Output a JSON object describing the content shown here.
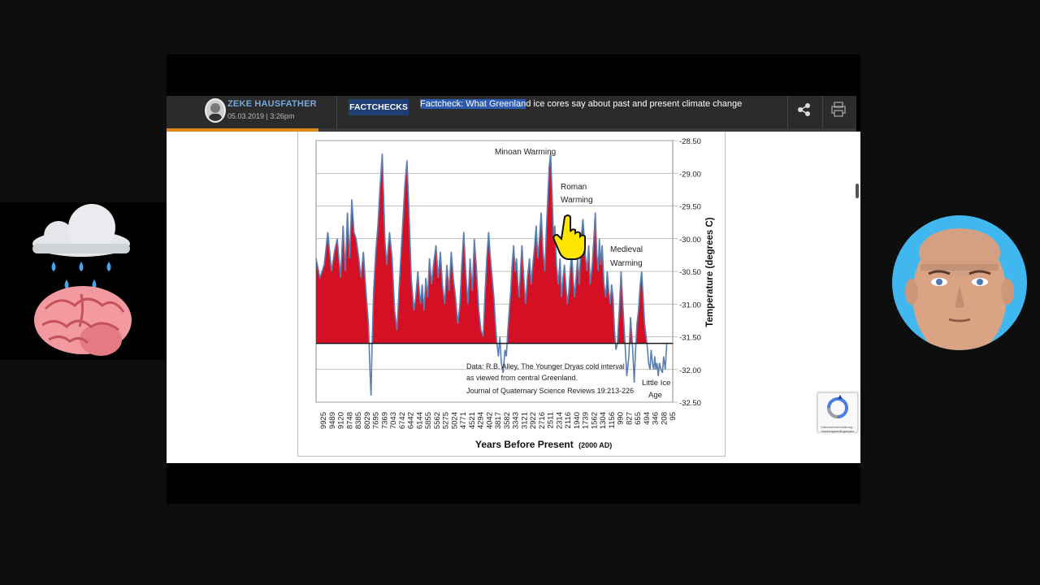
{
  "header": {
    "author_name": "ZEKE HAUSFATHER",
    "date": "05.03.2019 | 3:26pm",
    "category": "FACTCHECKS",
    "headline_selected": "Factcheck: What Greenlan",
    "headline_rest": "d ice cores say about past and present climate change",
    "progress": 0.22
  },
  "colors": {
    "fill": "#d50f24",
    "line": "#5a7fb2",
    "baseline": "#1a1a1a",
    "badge": "#1f3e73",
    "progress": "#e08a1e"
  },
  "icons": [
    "share-icon",
    "print-icon",
    "recaptcha-icon",
    "rain-cloud-icon",
    "brain-icon"
  ],
  "recaptcha_text": "Datenschutzerklärung - Nutzungsbedingungen",
  "chart_data": {
    "type": "area",
    "xlabel": "Years Before Present",
    "xlabel_small": "(2000 AD)",
    "ylabel": "Temperature (degrees C)",
    "ylim": [
      -32.5,
      -28.5
    ],
    "yticks": [
      "-28.50",
      "-29.00",
      "-29.50",
      "-30.00",
      "-30.50",
      "-31.00",
      "-31.50",
      "-32.00",
      "-32.50"
    ],
    "baseline": -31.6,
    "grid": true,
    "x_ticks": [
      "9925",
      "9489",
      "9120",
      "8748",
      "8385",
      "8029",
      "7695",
      "7369",
      "7043",
      "6742",
      "6442",
      "6144",
      "5855",
      "5562",
      "5275",
      "5024",
      "4771",
      "4521",
      "4294",
      "4042",
      "3817",
      "3582",
      "3343",
      "3121",
      "2922",
      "2716",
      "2511",
      "2314",
      "2116",
      "1940",
      "1739",
      "1562",
      "1304",
      "1156",
      "990",
      "827",
      "655",
      "494",
      "346",
      "208",
      "95"
    ],
    "x": [
      9925,
      9820,
      9700,
      9600,
      9500,
      9420,
      9340,
      9250,
      9180,
      9120,
      9060,
      9000,
      8940,
      8880,
      8820,
      8748,
      8690,
      8620,
      8550,
      8480,
      8440,
      8410,
      8385,
      8340,
      8280,
      8220,
      8160,
      8100,
      8060,
      8029,
      7980,
      7900,
      7830,
      7760,
      7695,
      7640,
      7560,
      7480,
      7420,
      7369,
      7300,
      7230,
      7180,
      7120,
      7080,
      7043,
      7000,
      6950,
      6900,
      6850,
      6800,
      6742,
      6690,
      6620,
      6560,
      6500,
      6442,
      6380,
      6320,
      6260,
      6200,
      6144,
      6080,
      6020,
      5960,
      5910,
      5855,
      5800,
      5740,
      5680,
      5620,
      5562,
      5500,
      5440,
      5380,
      5320,
      5275,
      5220,
      5170,
      5120,
      5070,
      5024,
      4980,
      4940,
      4900,
      4860,
      4820,
      4771,
      4720,
      4680,
      4640,
      4600,
      4560,
      4521,
      4480,
      4440,
      4400,
      4360,
      4330,
      4294,
      4250,
      4200,
      4150,
      4100,
      4042,
      4000,
      3950,
      3900,
      3860,
      3817,
      3770,
      3720,
      3670,
      3620,
      3582,
      3540,
      3500,
      3460,
      3420,
      3380,
      3343,
      3300,
      3250,
      3200,
      3160,
      3121,
      3080,
      3040,
      3000,
      2960,
      2922,
      2880,
      2840,
      2800,
      2760,
      2716,
      2670,
      2620,
      2570,
      2511,
      2460,
      2410,
      2370,
      2314,
      2270,
      2230,
      2190,
      2150,
      2116,
      2080,
      2040,
      1990,
      1940,
      1900,
      1860,
      1820,
      1780,
      1739,
      1700,
      1660,
      1620,
      1562,
      1520,
      1480,
      1440,
      1400,
      1360,
      1304,
      1260,
      1220,
      1190,
      1156,
      1120,
      1080,
      1040,
      990,
      950,
      910,
      870,
      827,
      790,
      760,
      720,
      690,
      655,
      620,
      590,
      560,
      530,
      494,
      460,
      420,
      380,
      346,
      300,
      260,
      208,
      170,
      130,
      95
    ],
    "values": [
      -30.3,
      -30.6,
      -30.4,
      -29.9,
      -30.5,
      -30.2,
      -30.0,
      -30.6,
      -29.8,
      -30.5,
      -29.6,
      -30.3,
      -29.4,
      -29.9,
      -30.0,
      -30.3,
      -30.6,
      -30.2,
      -30.8,
      -31.3,
      -32.0,
      -32.4,
      -31.7,
      -30.8,
      -30.2,
      -29.8,
      -29.2,
      -28.7,
      -29.4,
      -30.0,
      -30.4,
      -29.9,
      -30.3,
      -31.1,
      -31.4,
      -30.8,
      -30.0,
      -29.2,
      -28.8,
      -29.5,
      -30.6,
      -31.1,
      -30.9,
      -30.5,
      -30.8,
      -31.0,
      -30.7,
      -31.1,
      -30.6,
      -30.9,
      -30.3,
      -30.7,
      -30.4,
      -30.1,
      -30.6,
      -30.2,
      -30.7,
      -31.0,
      -30.4,
      -30.8,
      -30.2,
      -30.6,
      -30.9,
      -31.3,
      -31.0,
      -30.4,
      -29.9,
      -30.5,
      -31.0,
      -30.3,
      -30.8,
      -30.0,
      -30.5,
      -31.1,
      -31.4,
      -31.5,
      -30.9,
      -30.3,
      -29.9,
      -30.3,
      -30.6,
      -30.9,
      -31.3,
      -31.6,
      -31.8,
      -31.5,
      -31.9,
      -32.05,
      -31.7,
      -31.8,
      -31.4,
      -31.1,
      -30.8,
      -30.4,
      -30.1,
      -30.5,
      -30.3,
      -30.7,
      -30.9,
      -30.5,
      -30.1,
      -30.6,
      -31.0,
      -30.6,
      -30.3,
      -30.7,
      -30.4,
      -30.1,
      -29.8,
      -30.3,
      -30.0,
      -29.6,
      -30.2,
      -30.5,
      -29.9,
      -29.4,
      -28.9,
      -28.7,
      -29.3,
      -30.0,
      -29.8,
      -30.4,
      -30.7,
      -30.3,
      -30.9,
      -30.6,
      -30.4,
      -30.7,
      -31.0,
      -30.8,
      -30.5,
      -30.2,
      -30.6,
      -30.9,
      -30.6,
      -30.3,
      -30.7,
      -30.0,
      -29.7,
      -30.2,
      -30.5,
      -30.1,
      -30.7,
      -30.4,
      -30.0,
      -29.6,
      -30.2,
      -30.5,
      -30.0,
      -30.4,
      -30.1,
      -30.7,
      -30.9,
      -30.5,
      -30.8,
      -31.0,
      -30.7,
      -30.9,
      -31.4,
      -31.7,
      -31.6,
      -31.0,
      -30.5,
      -30.9,
      -31.3,
      -31.7,
      -32.1,
      -31.8,
      -31.2,
      -31.5,
      -31.8,
      -32.2,
      -31.7,
      -31.3,
      -31.1,
      -30.7,
      -30.5,
      -30.9,
      -31.3,
      -31.5,
      -31.7,
      -31.9,
      -32.0,
      -31.7,
      -31.9,
      -32.0,
      -31.8,
      -32.0,
      -31.9,
      -32.1,
      -31.9,
      -32.0,
      -32.05,
      -31.8,
      -32.0,
      -31.6
    ]
  },
  "annotations": [
    {
      "id": "minoan",
      "text": "Minoan Warming"
    },
    {
      "id": "roman-1",
      "text": "Roman"
    },
    {
      "id": "roman-2",
      "text": "Warming"
    },
    {
      "id": "medieval-1",
      "text": "Medieval"
    },
    {
      "id": "medieval-2",
      "text": "Warming"
    },
    {
      "id": "src-1",
      "text": "Data: R.B. Alley,  The Younger Dryas cold interval"
    },
    {
      "id": "src-2",
      "text": "as viewed from central Greenland."
    },
    {
      "id": "src-3",
      "text": "Journal of Quaternary  Science Reviews 19:213-226"
    },
    {
      "id": "lia-1",
      "text": "Little Ice"
    },
    {
      "id": "lia-2",
      "text": "Age"
    }
  ]
}
